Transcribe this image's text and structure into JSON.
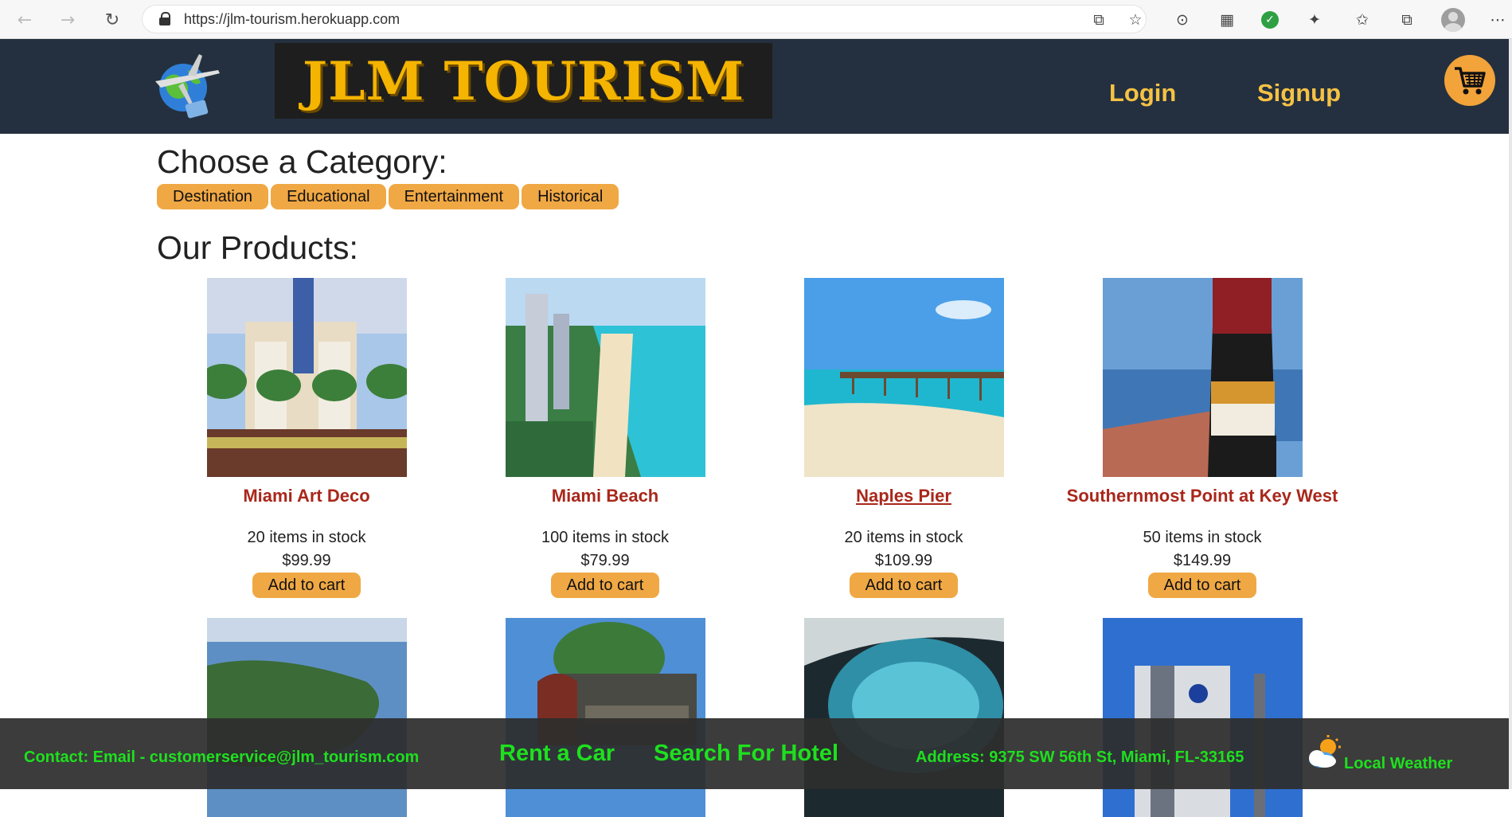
{
  "browser": {
    "url": "https://jlm-tourism.herokuapp.com",
    "back_icon": "←",
    "forward_icon": "→",
    "reload_icon": "↻",
    "external_icon": "⧉",
    "favorite_add_icon": "☆",
    "reader_icon": "⊙",
    "wallet_icon": "▦",
    "check_icon": "✓",
    "extensions_icon": "✦",
    "favorites_icon": "✩",
    "collections_icon": "⧉",
    "menu_icon": "⋯"
  },
  "header": {
    "brand": "JLM TOURISM",
    "login": "Login",
    "signup": "Signup"
  },
  "categories": {
    "title": "Choose a Category:",
    "items": [
      "Destination",
      "Educational",
      "Entertainment",
      "Historical"
    ]
  },
  "products": {
    "title": "Our Products:",
    "items": [
      {
        "name": "Miami Art Deco",
        "stock": "20 items in stock",
        "price": "$99.99",
        "button": "Add to cart"
      },
      {
        "name": "Miami Beach",
        "stock": "100 items in stock",
        "price": "$79.99",
        "button": "Add to cart"
      },
      {
        "name": "Naples Pier",
        "stock": "20 items in stock",
        "price": "$109.99",
        "button": "Add to cart"
      },
      {
        "name": "Southernmost Point at Key West",
        "stock": "50 items in stock",
        "price": "$149.99",
        "button": "Add to cart"
      }
    ]
  },
  "footer": {
    "contact": "Contact: Email - customerservice@jlm_tourism.com",
    "rent_car": "Rent a Car",
    "search_hotel": "Search For Hotel",
    "address": "Address: 9375 SW 56th St, Miami, FL-33165",
    "weather": "Local Weather"
  },
  "colors": {
    "header_bg": "#24303f",
    "accent": "#f0a844",
    "brand_text": "#f4b400",
    "product_name": "#a9271b",
    "footer_text": "#1ee01e"
  }
}
